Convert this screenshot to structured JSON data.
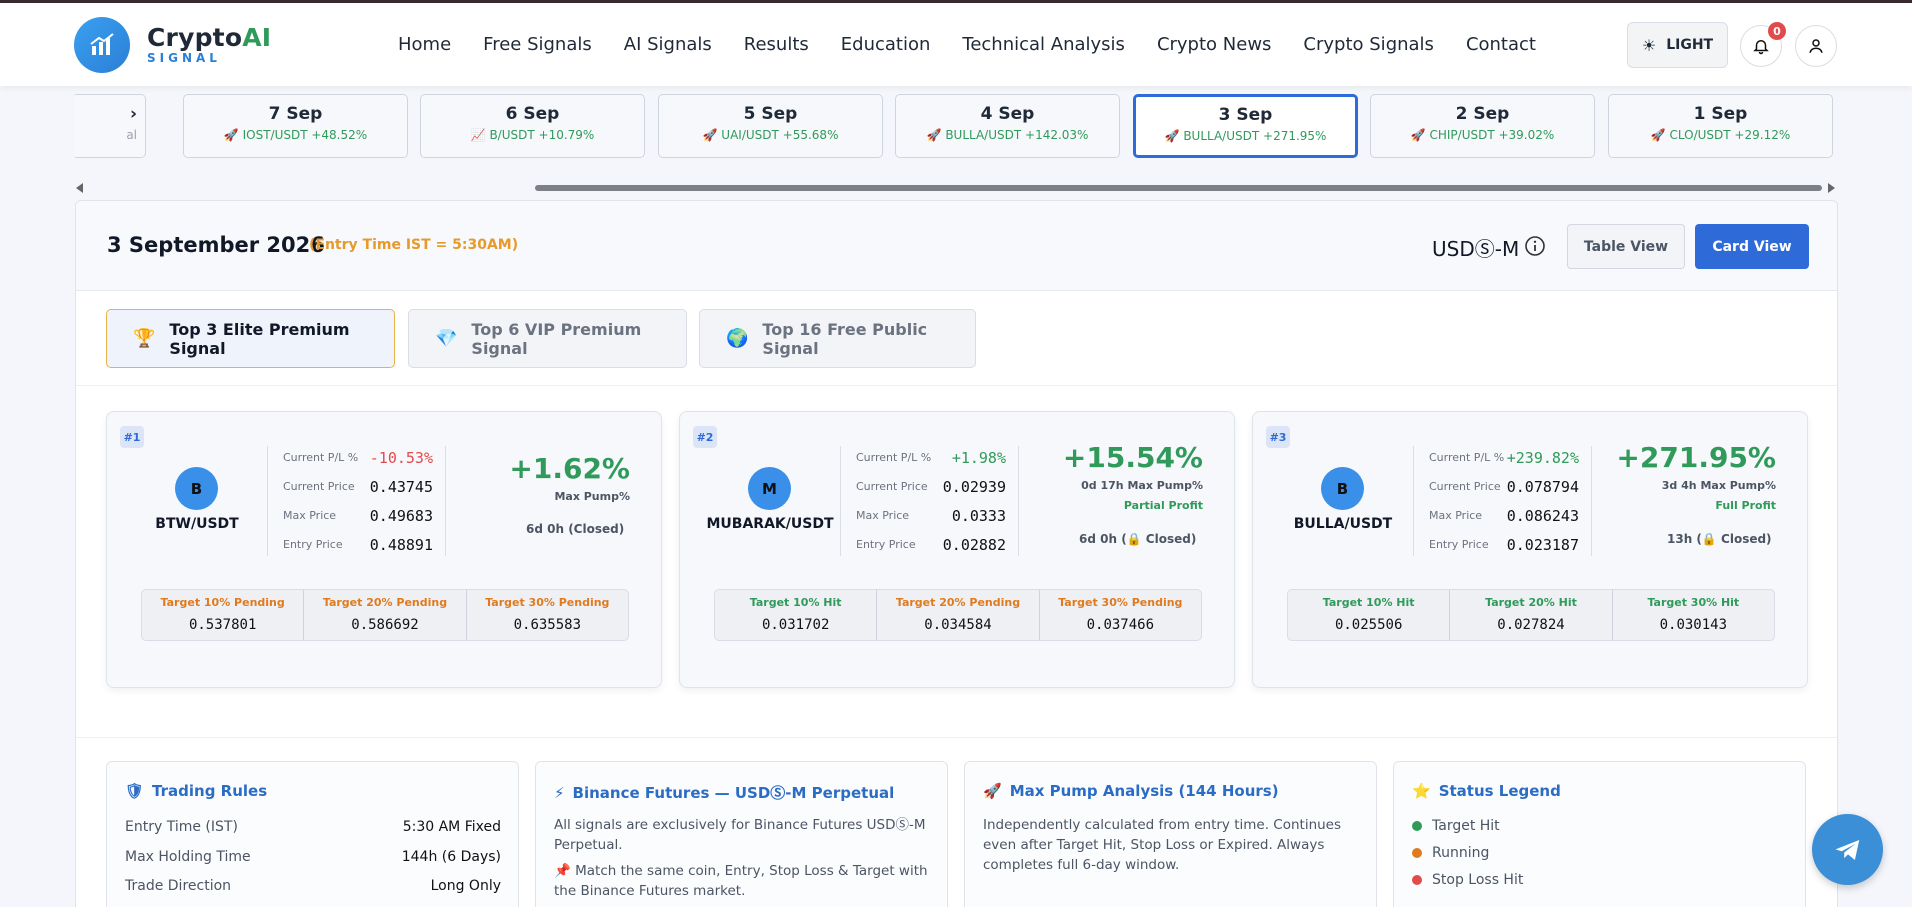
{
  "brand": {
    "name_main": "Crypto",
    "name_accent": "AI",
    "sub": "SIGNAL"
  },
  "nav": [
    "Home",
    "Free Signals",
    "AI Signals",
    "Results",
    "Education",
    "Technical Analysis",
    "Crypto News",
    "Crypto Signals",
    "Contact"
  ],
  "header": {
    "theme_label": "LIGHT",
    "notification_count": "0"
  },
  "date_strip": [
    {
      "date": "",
      "signal": "al",
      "emoji": ""
    },
    {
      "date": "7 Sep",
      "signal": "IOST/USDT +48.52%",
      "emoji": "🚀"
    },
    {
      "date": "6 Sep",
      "signal": "B/USDT +10.79%",
      "emoji": "📈"
    },
    {
      "date": "5 Sep",
      "signal": "UAI/USDT +55.68%",
      "emoji": "🚀"
    },
    {
      "date": "4 Sep",
      "signal": "BULLA/USDT +142.03%",
      "emoji": "🚀"
    },
    {
      "date": "3 Sep",
      "signal": "BULLA/USDT +271.95%",
      "emoji": "🚀"
    },
    {
      "date": "2 Sep",
      "signal": "CHIP/USDT +39.02%",
      "emoji": "🚀"
    },
    {
      "date": "1 Sep",
      "signal": "CLO/USDT +29.12%",
      "emoji": "🚀"
    }
  ],
  "main": {
    "date_title": "3 September 2026",
    "entry_note": "(Entry Time IST = 5:30AM)",
    "market_label": "USDⓈ-M",
    "table_view": "Table View",
    "card_view": "Card View"
  },
  "tabs": [
    {
      "label": "Top 3 Elite Premium Signal",
      "icon": "🏆"
    },
    {
      "label": "Top 6 VIP Premium Signal",
      "icon": "💎"
    },
    {
      "label": "Top 16 Free Public Signal",
      "icon": "🌍"
    }
  ],
  "labels": {
    "current_pl": "Current P/L %",
    "current_price": "Current Price",
    "max_price": "Max Price",
    "entry_price": "Entry Price"
  },
  "cards": [
    {
      "rank": "#1",
      "coin_letter": "B",
      "pair": "BTW/USDT",
      "current_pl": "-10.53%",
      "current_price": "0.43745",
      "max_price": "0.49683",
      "entry_price": "0.48891",
      "max_pump": "+1.62%",
      "pump_label": "Max Pump%",
      "profit": "",
      "closed": "6d 0h (Closed)",
      "targets": [
        {
          "label": "Target 10% Pending",
          "value": "0.537801",
          "status": "pending"
        },
        {
          "label": "Target 20% Pending",
          "value": "0.586692",
          "status": "pending"
        },
        {
          "label": "Target 30% Pending",
          "value": "0.635583",
          "status": "pending"
        }
      ]
    },
    {
      "rank": "#2",
      "coin_letter": "M",
      "pair": "MUBARAK/USDT",
      "current_pl": "+1.98%",
      "current_price": "0.02939",
      "max_price": "0.0333",
      "entry_price": "0.02882",
      "max_pump": "+15.54%",
      "pump_label": "0d 17h Max Pump%",
      "profit": "Partial Profit",
      "closed": "6d 0h (🔒 Closed)",
      "targets": [
        {
          "label": "Target 10% Hit",
          "value": "0.031702",
          "status": "hit"
        },
        {
          "label": "Target 20% Pending",
          "value": "0.034584",
          "status": "pending"
        },
        {
          "label": "Target 30% Pending",
          "value": "0.037466",
          "status": "pending"
        }
      ]
    },
    {
      "rank": "#3",
      "coin_letter": "B",
      "pair": "BULLA/USDT",
      "current_pl": "+239.82%",
      "current_price": "0.078794",
      "max_price": "0.086243",
      "entry_price": "0.023187",
      "max_pump": "+271.95%",
      "pump_label": "3d 4h Max Pump%",
      "profit": "Full Profit",
      "closed": "13h (🔒 Closed)",
      "targets": [
        {
          "label": "Target 10% Hit",
          "value": "0.025506",
          "status": "hit"
        },
        {
          "label": "Target 20% Hit",
          "value": "0.027824",
          "status": "hit"
        },
        {
          "label": "Target 30% Hit",
          "value": "0.030143",
          "status": "hit"
        }
      ]
    }
  ],
  "info": {
    "rules_title": "Trading Rules",
    "rules": [
      {
        "k": "Entry Time (IST)",
        "v": "5:30 AM Fixed"
      },
      {
        "k": "Max Holding Time",
        "v": "144h (6 Days)"
      },
      {
        "k": "Trade Direction",
        "v": "Long Only"
      }
    ],
    "binance_title": "Binance Futures — USDⓈ-M Perpetual",
    "binance_text1": "All signals are exclusively for Binance Futures USDⓈ-M Perpetual.",
    "binance_text2": "📌 Match the same coin, Entry, Stop Loss & Target with the Binance Futures market.",
    "pump_title": "Max Pump Analysis (144 Hours)",
    "pump_text": "Independently calculated from entry time. Continues even after Target Hit, Stop Loss or Expired. Always completes full 6-day window.",
    "legend_title": "Status Legend",
    "legend": [
      {
        "label": "Target Hit",
        "color": "#2f9a5a"
      },
      {
        "label": "Running",
        "color": "#e07a1f"
      },
      {
        "label": "Stop Loss Hit",
        "color": "#e24b4b"
      }
    ]
  },
  "colors": {
    "accent": "#2f6bd8",
    "positive": "#2f9a5a",
    "negative": "#e24b4b",
    "warning": "#e69a2b"
  }
}
